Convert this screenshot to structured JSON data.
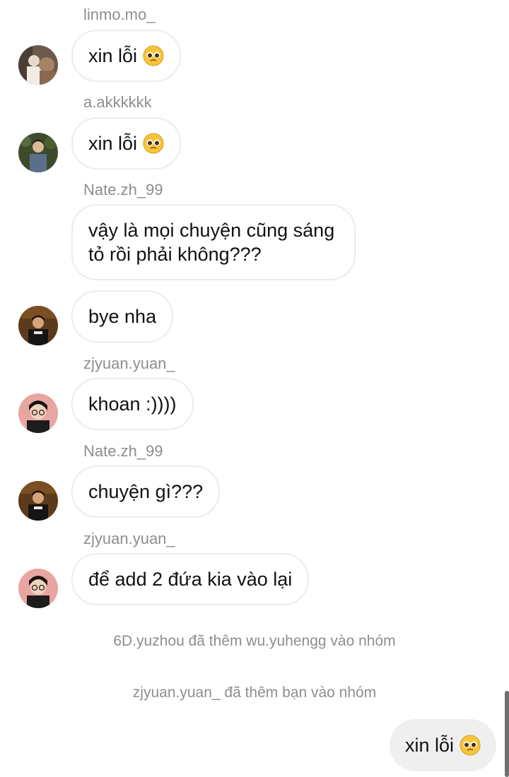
{
  "messages": [
    {
      "sender": "linmo.mo_",
      "text": "xin lỗi",
      "emoji": "pleading-face-emoji"
    },
    {
      "sender": "a.akkkkkk",
      "text": "xin lỗi",
      "emoji": "pleading-face-emoji"
    },
    {
      "sender": "Nate.zh_99",
      "text": "vậy là mọi chuyện cũng sáng tỏ rồi phải không???"
    },
    {
      "text": "bye nha"
    },
    {
      "sender": "zjyuan.yuan_",
      "text": "khoan :))))"
    },
    {
      "sender": "Nate.zh_99",
      "text": "chuyện gì???"
    },
    {
      "sender": "zjyuan.yuan_",
      "text": "để add 2 đứa kia vào lại"
    }
  ],
  "system_messages": [
    "6D.yuzhou đã thêm wu.yuhengg vào nhóm",
    "zjyuan.yuan_ đã thêm bạn vào nhóm"
  ],
  "my_message": {
    "text": "xin lỗi",
    "emoji": "pleading-face-emoji"
  },
  "colors": {
    "sender_gray": "#8e8e8e",
    "bubble_border": "#ececec",
    "my_bubble": "#efefef"
  }
}
